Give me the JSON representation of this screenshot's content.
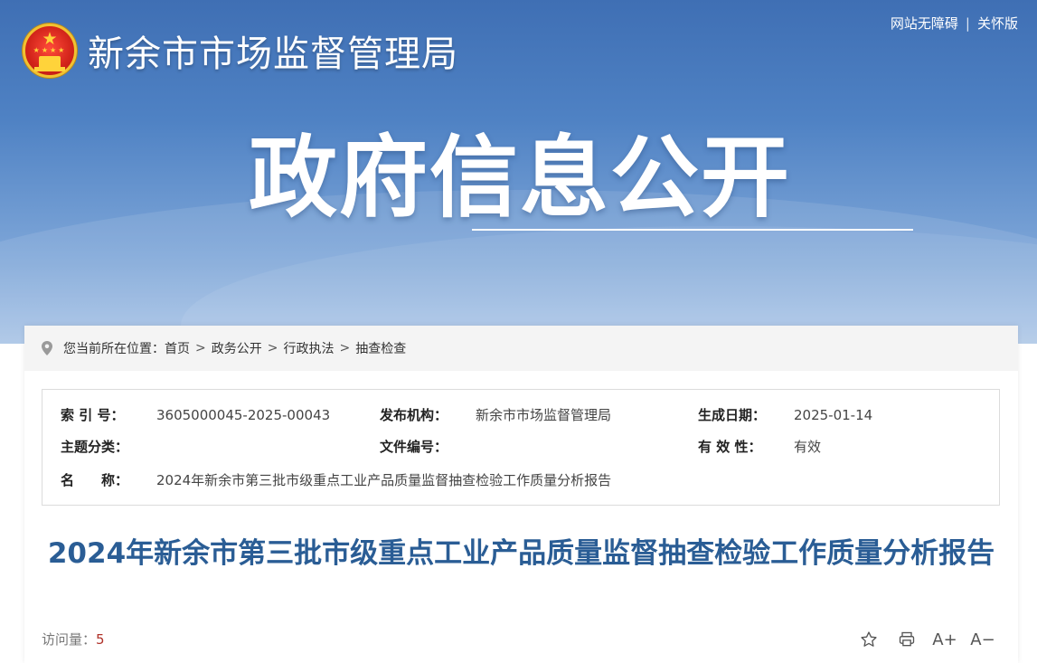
{
  "header": {
    "site_name": "新余市市场监督管理局",
    "links": [
      "网站无障碍",
      "关怀版"
    ],
    "link_separator": "|",
    "banner_title": "政府信息公开"
  },
  "breadcrumb": {
    "prefix": "您当前所在位置：",
    "items": [
      "首页",
      "政务公开",
      "行政执法",
      "抽查检查"
    ],
    "separator": ">"
  },
  "meta": {
    "index_label": "索 引 号：",
    "index_value": "3605000045-2025-00043",
    "org_label": "发布机构：",
    "org_value": "新余市市场监督管理局",
    "date_label": "生成日期：",
    "date_value": "2025-01-14",
    "topic_label": "主题分类：",
    "topic_value": "",
    "docno_label": "文件编号：",
    "docno_value": "",
    "valid_label": "有 效 性：",
    "valid_value": "有效",
    "name_label": "名　　称：",
    "name_value": "2024年新余市第三批市级重点工业产品质量监督抽查检验工作质量分析报告"
  },
  "article": {
    "title": "2024年新余市第三批市级重点工业产品质量监督抽查检验工作质量分析报告",
    "visits_label": "访问量：",
    "visits_count": "5"
  },
  "tools": {
    "icons": [
      "star-icon",
      "print-icon",
      "font-increase-icon",
      "font-decrease-icon"
    ],
    "font_increase_glyph": "A+",
    "font_decrease_glyph": "A−"
  },
  "colors": {
    "banner_top": "#3f6fb4",
    "title_blue": "#2a5d95",
    "visit_count": "#b0322a"
  }
}
